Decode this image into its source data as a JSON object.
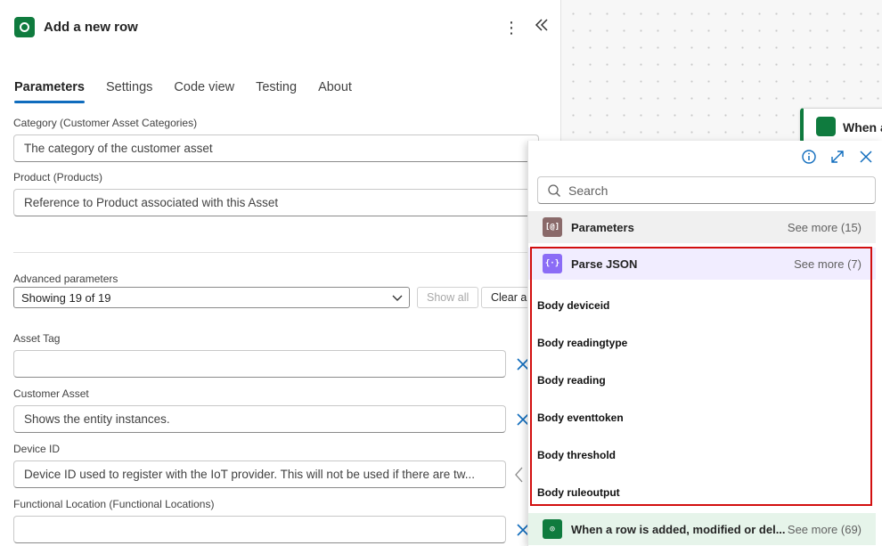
{
  "panel": {
    "title": "Add a new row",
    "tabs": [
      "Parameters",
      "Settings",
      "Code view",
      "Testing",
      "About"
    ],
    "active_tab": "Parameters",
    "fields": {
      "category_label": "Category (Customer Asset Categories)",
      "category_value": "The category of the customer asset",
      "product_label": "Product (Products)",
      "product_value": "Reference to Product associated with this Asset",
      "advanced_label": "Advanced parameters",
      "advanced_value": "Showing 19 of 19",
      "show_all": "Show all",
      "clear_all": "Clear all",
      "asset_tag_label": "Asset Tag",
      "asset_tag_value": "",
      "customer_asset_label": "Customer Asset",
      "customer_asset_value": "Shows the entity instances.",
      "device_id_label": "Device ID",
      "device_id_value": "Device ID used to register with the IoT provider. This will not be used if there are tw...",
      "functional_location_label": "Functional Location (Functional Locations)",
      "functional_location_value": ""
    }
  },
  "canvas": {
    "trigger_card_title": "When a"
  },
  "flyout": {
    "search_placeholder": "Search",
    "groups": {
      "parameters": {
        "name": "Parameters",
        "see_more": "See more (15)"
      },
      "parse_json": {
        "name": "Parse JSON",
        "see_more": "See more (7)"
      },
      "trigger": {
        "name": "When a row is added, modified or del...",
        "see_more": "See more (69)"
      }
    },
    "items": [
      "Body deviceid",
      "Body readingtype",
      "Body reading",
      "Body eventtoken",
      "Body threshold",
      "Body ruleoutput"
    ]
  },
  "colors": {
    "dataverse_green": "#0f7b3e",
    "parse_json_purple": "#8b6cf6",
    "highlight_red": "#d20f0f",
    "tab_accent": "#0f6cbd"
  }
}
